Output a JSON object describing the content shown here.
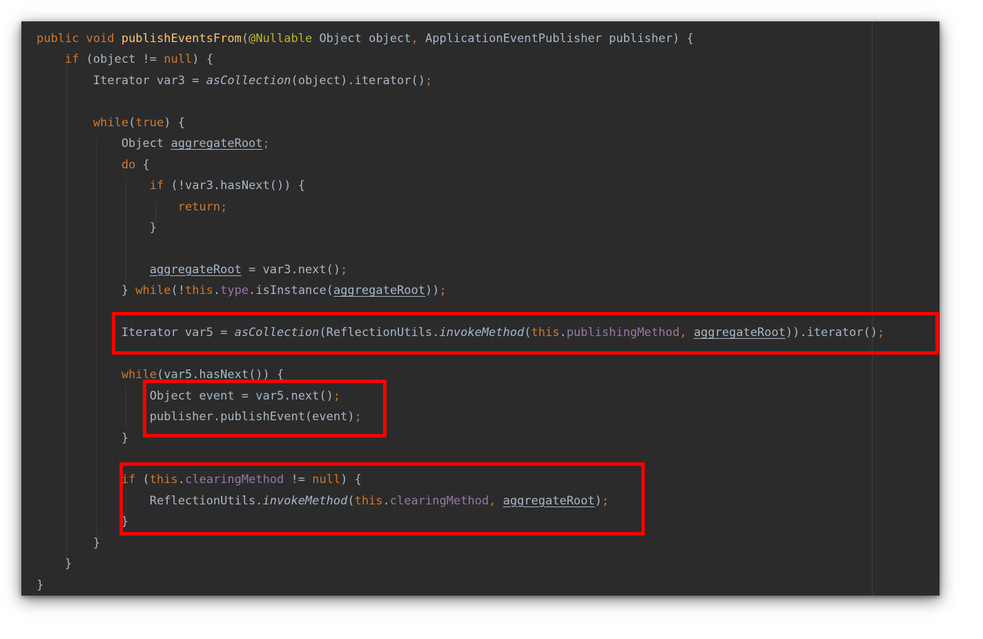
{
  "code_lines": [
    [
      {
        "t": "public void ",
        "c": "kw"
      },
      {
        "t": "publishEventsFrom",
        "c": "fn"
      },
      {
        "t": "("
      },
      {
        "t": "@Nullable",
        "c": "an"
      },
      {
        "t": " Object object"
      },
      {
        "t": ",",
        "c": "kw"
      },
      {
        "t": " ApplicationEventPublisher publisher) {"
      }
    ],
    [
      {
        "t": "    "
      },
      {
        "t": "if",
        "c": "kw"
      },
      {
        "t": " (object != "
      },
      {
        "t": "null",
        "c": "kw"
      },
      {
        "t": ") {"
      }
    ],
    [
      {
        "t": "        Iterator var3 = "
      },
      {
        "t": "asCollection",
        "c": "it"
      },
      {
        "t": "(object).iterator()"
      },
      {
        "t": ";",
        "c": "kw"
      }
    ],
    [],
    [
      {
        "t": "        "
      },
      {
        "t": "while",
        "c": "kw"
      },
      {
        "t": "("
      },
      {
        "t": "true",
        "c": "kw"
      },
      {
        "t": ") {"
      }
    ],
    [
      {
        "t": "            Object "
      },
      {
        "t": "aggregateRoot",
        "c": "ul"
      },
      {
        "t": ";",
        "c": "kw"
      }
    ],
    [
      {
        "t": "            "
      },
      {
        "t": "do",
        "c": "kw"
      },
      {
        "t": " {"
      }
    ],
    [
      {
        "t": "                "
      },
      {
        "t": "if",
        "c": "kw"
      },
      {
        "t": " (!var3.hasNext()) {"
      }
    ],
    [
      {
        "t": "                    "
      },
      {
        "t": "return;",
        "c": "kw"
      }
    ],
    [
      {
        "t": "                }"
      }
    ],
    [],
    [
      {
        "t": "                "
      },
      {
        "t": "aggregateRoot",
        "c": "ul"
      },
      {
        "t": " = var3.next()"
      },
      {
        "t": ";",
        "c": "kw"
      }
    ],
    [
      {
        "t": "            } "
      },
      {
        "t": "while",
        "c": "kw"
      },
      {
        "t": "(!"
      },
      {
        "t": "this",
        "c": "kw"
      },
      {
        "t": "."
      },
      {
        "t": "type",
        "c": "fld"
      },
      {
        "t": ".isInstance("
      },
      {
        "t": "aggregateRoot",
        "c": "ul"
      },
      {
        "t": "))"
      },
      {
        "t": ";",
        "c": "kw"
      }
    ],
    [],
    [
      {
        "t": "            Iterator var5 = "
      },
      {
        "t": "asCollection",
        "c": "it"
      },
      {
        "t": "(ReflectionUtils."
      },
      {
        "t": "invokeMethod",
        "c": "it"
      },
      {
        "t": "("
      },
      {
        "t": "this",
        "c": "kw"
      },
      {
        "t": "."
      },
      {
        "t": "publishingMethod",
        "c": "fld"
      },
      {
        "t": ", ",
        "c": "kw"
      },
      {
        "t": "aggregateRoot",
        "c": "ul"
      },
      {
        "t": ")).iterator()"
      },
      {
        "t": ";",
        "c": "kw"
      }
    ],
    [],
    [
      {
        "t": "            "
      },
      {
        "t": "while",
        "c": "kw"
      },
      {
        "t": "(var5.hasNext()) {"
      }
    ],
    [
      {
        "t": "                Object event = var5.next()"
      },
      {
        "t": ";",
        "c": "kw"
      }
    ],
    [
      {
        "t": "                publisher.publishEvent(event)"
      },
      {
        "t": ";",
        "c": "kw"
      }
    ],
    [
      {
        "t": "            }"
      }
    ],
    [],
    [
      {
        "t": "            "
      },
      {
        "t": "if",
        "c": "kw"
      },
      {
        "t": " ("
      },
      {
        "t": "this",
        "c": "kw"
      },
      {
        "t": "."
      },
      {
        "t": "clearingMethod",
        "c": "fld"
      },
      {
        "t": " != "
      },
      {
        "t": "null",
        "c": "kw"
      },
      {
        "t": ") {"
      }
    ],
    [
      {
        "t": "                ReflectionUtils."
      },
      {
        "t": "invokeMethod",
        "c": "it"
      },
      {
        "t": "("
      },
      {
        "t": "this",
        "c": "kw"
      },
      {
        "t": "."
      },
      {
        "t": "clearingMethod",
        "c": "fld"
      },
      {
        "t": ", ",
        "c": "kw"
      },
      {
        "t": "aggregateRoot",
        "c": "ul"
      },
      {
        "t": ")"
      },
      {
        "t": ";",
        "c": "kw"
      }
    ],
    [
      {
        "t": "            }"
      }
    ],
    [
      {
        "t": "        }"
      }
    ],
    [
      {
        "t": "    }"
      }
    ],
    [
      {
        "t": "}"
      }
    ]
  ],
  "colors": {
    "background": "#2b2b2b",
    "text": "#a9b7c6",
    "keyword": "#cc7832",
    "method_declaration": "#ffc66d",
    "annotation": "#bbb529",
    "field": "#9876aa",
    "highlight_box": "#ff0000"
  }
}
